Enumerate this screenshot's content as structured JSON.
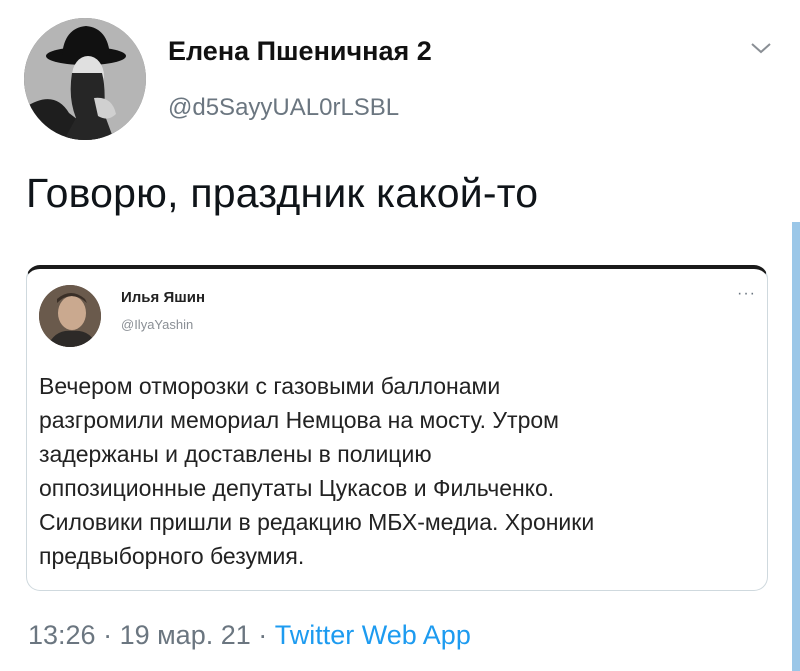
{
  "author": {
    "name": "Елена Пшеничная 2",
    "handle": "@d5SayyUAL0rLSBL"
  },
  "tweet": {
    "text": "Говорю, праздник какой-то"
  },
  "quoted": {
    "name": "Илья Яшин",
    "handle": "@IlyaYashin",
    "more": "···",
    "lines": [
      "Вечером отморозки с газовыми баллонами",
      "разгромили мемориал Немцова на мосту. Утром",
      "задержаны и доставлены в полицию",
      "оппозиционные депутаты Цукасов и Фильченко.",
      "Силовики пришли в редакцию МБХ-медиа. Хроники",
      "предвыборного безумия."
    ]
  },
  "meta": {
    "time": "13:26",
    "separator": " · ",
    "date": "19 мар. 21",
    "app": "Twitter Web App"
  },
  "icons": {
    "menu": "chevron-down-icon",
    "quote_menu": "more-icon"
  },
  "colors": {
    "link": "#1d9bf0",
    "secondary_text": "#6b7680",
    "border": "#cfd9de"
  }
}
